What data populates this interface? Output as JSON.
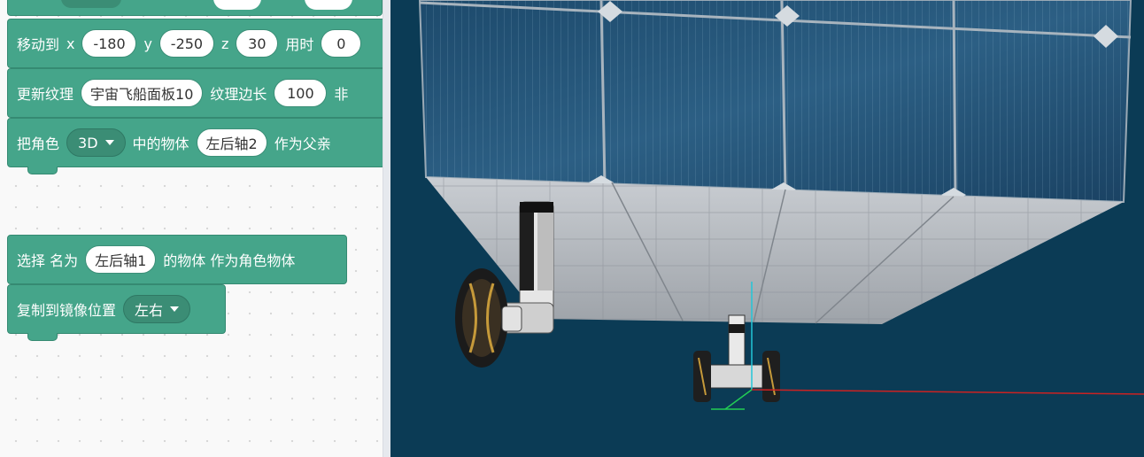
{
  "blocks": {
    "move": {
      "label": "移动到",
      "x_label": "x",
      "x": "-180",
      "y_label": "y",
      "y": "-250",
      "z_label": "z",
      "z": "30",
      "time_label": "用时",
      "time": "0"
    },
    "texture": {
      "label": "更新纹理",
      "name": "宇宙飞船面板10",
      "side_label": "纹理边长",
      "side": "100",
      "trail": "非"
    },
    "parent": {
      "label": "把角色",
      "role": "3D",
      "mid": "中的物体",
      "object": "左后轴2",
      "suffix": "作为父亲"
    },
    "select": {
      "label": "选择 名为",
      "object": "左后轴1",
      "suffix": "的物体 作为角色物体"
    },
    "mirror": {
      "label": "复制到镜像位置",
      "option": "左右"
    }
  },
  "colors": {
    "block": "#45a58a",
    "viewport": "#0b3b55",
    "x_axis": "#cc2222",
    "y_axis": "#22cc55",
    "z_axis": "#22c6d8"
  }
}
